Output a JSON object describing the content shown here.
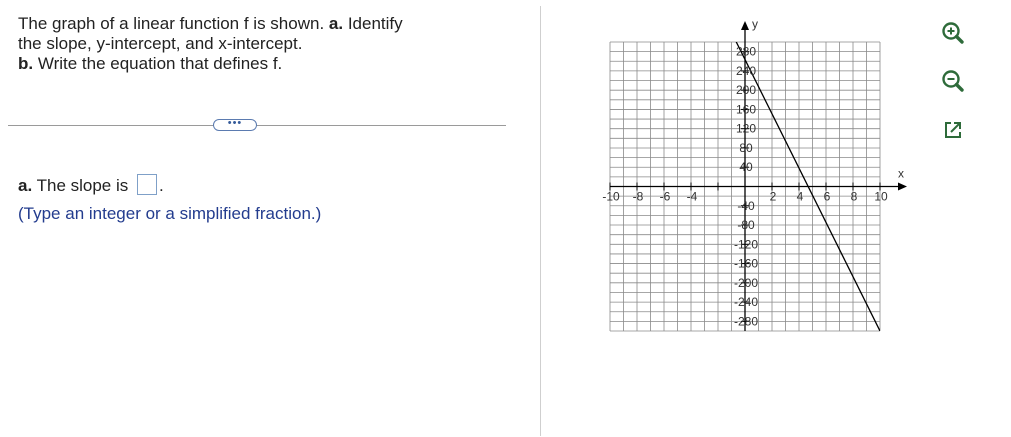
{
  "question": {
    "line1_prefix": "The graph of a linear function f is shown. ",
    "line1_bold": "a.",
    "line1_suffix": " Identify",
    "line2": "the slope, y-intercept, and x-intercept.",
    "line3_bold": "b.",
    "line3_suffix": " Write the equation that defines f."
  },
  "more_button_label": "•••",
  "part_a": {
    "label_bold": "a.",
    "text": " The slope is ",
    "after": ".",
    "slope_value": "",
    "instruction": "(Type an integer or a simplified fraction.)"
  },
  "chart_data": {
    "type": "line",
    "xlabel": "x",
    "ylabel": "y",
    "xlim": [
      -10,
      10
    ],
    "ylim": [
      -300,
      300
    ],
    "x_ticks": [
      -10,
      -8,
      -6,
      -4,
      -2,
      2,
      4,
      6,
      8,
      10
    ],
    "x_tick_labels": [
      "-10",
      "-8",
      "-6",
      "-4",
      "",
      "2",
      "4",
      "6",
      "8",
      "10"
    ],
    "y_ticks": [
      -280,
      -240,
      -200,
      -160,
      -120,
      -80,
      -40,
      40,
      80,
      120,
      160,
      200,
      240,
      280
    ],
    "y_tick_labels": [
      "-280",
      "-240",
      "-200",
      "-160",
      "-120",
      "-80",
      "-40",
      "40",
      "80",
      "120",
      "160",
      "200",
      "240",
      "280"
    ],
    "grid": true,
    "grid_x_step": 1,
    "grid_y_step": 20,
    "series": [
      {
        "points": [
          [
            -1,
            320
          ],
          [
            10,
            -300
          ]
        ]
      }
    ],
    "colors": {
      "grid": "#8a8a8a",
      "axis": "#000000",
      "line": "#000000"
    }
  },
  "tools": {
    "zoom_in_icon": "zoom-in-icon",
    "zoom_out_icon": "zoom-out-icon",
    "popout_icon": "popout-icon"
  }
}
